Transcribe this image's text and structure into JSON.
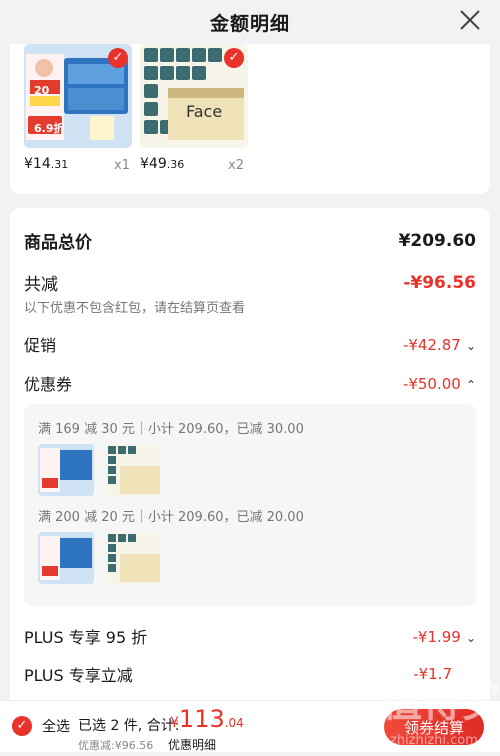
{
  "header": {
    "title": "金额明细"
  },
  "products": [
    {
      "price_int": "¥14",
      "price_dec": ".31",
      "qty": "x1",
      "name": "vinda-tissue-box"
    },
    {
      "price_int": "¥49",
      "price_dec": ".36",
      "qty": "x2",
      "name": "face-tissue-pack"
    }
  ],
  "product_art": {
    "p1_badge_text": "6.9折",
    "p1_badge_small": "20",
    "p2_brand": "Face"
  },
  "summary": {
    "total_label": "商品总价",
    "total_value": "¥209.60",
    "reduce_label": "共减",
    "reduce_value": "-¥96.56",
    "reduce_note": "以下优惠不包含红包，请在结算页查看",
    "promo_label": "促销",
    "promo_value": "-¥42.87",
    "coupon_label": "优惠券",
    "coupon_value": "-¥50.00",
    "plus95_label": "PLUS 专享 95 折",
    "plus95_value": "-¥1.99",
    "plus_reduce_label": "PLUS 专享立减",
    "plus_reduce_value": "-¥1.7"
  },
  "coupons": [
    {
      "title": "满 169 减 30 元｜小计 209.60，已减 30.00"
    },
    {
      "title": "满 200 减 20 元｜小计 209.60，已减 20.00"
    }
  ],
  "bottom": {
    "select_all": "全选",
    "selected": "已选 2 件, 合计:",
    "total_symbol": "¥",
    "total_int": "113",
    "total_dec": ".04",
    "discount": "优惠减:¥96.56",
    "detail": "优惠明细",
    "button": "领券结算"
  },
  "watermark": {
    "text": "值得买",
    "site": "zhizhizhi.com"
  },
  "colors": {
    "accent": "#e8322a",
    "background": "#f2f2f2"
  }
}
